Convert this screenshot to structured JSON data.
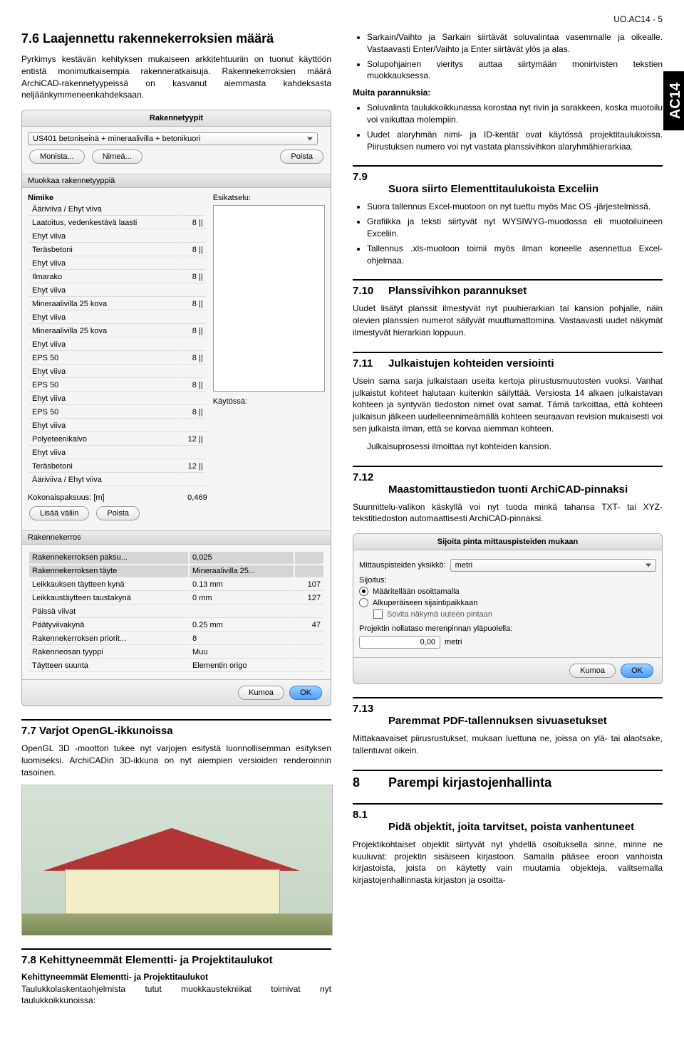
{
  "meta": {
    "top_right": "UO.AC14 - 5",
    "tab": "AC14"
  },
  "left": {
    "h76": "7.6   Laajennettu rakennekerroksien määrä",
    "p76": "Pyrkimys kestävän kehityksen mukaiseen arkkitehtuuriin on tuonut käyttöön entistä monimutkaisempia rakenneratkaisuja. Rakennekerroksien määrä ArchiCAD-rakennetyypeissä on kasvanut aiemmasta kahdeksasta neljäänkymmeneenkahdeksaan.",
    "panel1": {
      "title": "Rakennetyypit",
      "combo": "US401 betoniseinä + mineraalivilla + betonikuori",
      "btns": {
        "monista": "Monista...",
        "nimea": "Nimeä...",
        "poista": "Poista"
      },
      "sect1": "Muokkaa rakennetyyppiä",
      "col_head_l": "Nimike",
      "col_preview": "Esikatselu:",
      "rows": [
        {
          "name": "Ääriviiva / Ehyt viiva",
          "v": ""
        },
        {
          "name": "Laatoitus, vedenkestävä laasti",
          "v": "8"
        },
        {
          "name": "Ehyt viiva",
          "v": ""
        },
        {
          "name": "Teräsbetoni",
          "v": "8"
        },
        {
          "name": "Ehyt viiva",
          "v": ""
        },
        {
          "name": "Ilmarako",
          "v": "8"
        },
        {
          "name": "Ehyt viiva",
          "v": ""
        },
        {
          "name": "Mineraalivilla 25 kova",
          "v": "8"
        },
        {
          "name": "Ehyt viiva",
          "v": ""
        },
        {
          "name": "Mineraalivilla 25 kova",
          "v": "8"
        },
        {
          "name": "Ehyt viiva",
          "v": ""
        },
        {
          "name": "EPS 50",
          "v": "8"
        },
        {
          "name": "Ehyt viiva",
          "v": ""
        },
        {
          "name": "EPS 50",
          "v": "8"
        },
        {
          "name": "Ehyt viiva",
          "v": ""
        },
        {
          "name": "EPS 50",
          "v": "8"
        },
        {
          "name": "Ehyt viiva",
          "v": ""
        },
        {
          "name": "Polyeteenikalvo",
          "v": "12"
        },
        {
          "name": "Ehyt viiva",
          "v": ""
        },
        {
          "name": "Teräsbetoni",
          "v": "12"
        },
        {
          "name": "Ääriviiva / Ehyt viiva",
          "v": ""
        }
      ],
      "thickness_lbl": "Kokonaispaksuus: [m]",
      "thickness_val": "0,469",
      "kaytossa": "Käytössä:",
      "lisaa": "Lisää väliin",
      "poista2": "Poista",
      "sect2": "Rakennekerros",
      "rk_rows": [
        {
          "l": "Rakennekerroksen paksu...",
          "r": "0,025"
        },
        {
          "l": "Rakennekerroksen täyte",
          "r": "Mineraalivilla 25..."
        },
        {
          "l": "Leikkauksen täytteen kynä",
          "r": "0.13 mm",
          "r2": "107"
        },
        {
          "l": "Leikkaustäytteen taustakynä",
          "r": "0 mm",
          "r2": "127"
        },
        {
          "l": "Päissä viivat",
          "r": ""
        },
        {
          "l": "Päätyviivakynä",
          "r": "0.25 mm",
          "r2": "47"
        },
        {
          "l": "Rakennekerroksen priorit...",
          "r": "8"
        },
        {
          "l": "Rakenneosan tyyppi",
          "r": "Muu"
        },
        {
          "l": "Täytteen suunta",
          "r": "Elementin origo"
        }
      ],
      "kumoa": "Kumoa",
      "ok": "OK"
    },
    "h77": "7.7   Varjot OpenGL-ikkunoissa",
    "p77": "OpenGL 3D -moottori tukee nyt varjojen esitystä luonnollisemman esityksen luomiseksi. ArchiCADin 3D-ikkuna on nyt aiempien versioiden renderoinnin tasoinen.",
    "h78": "7.8   Kehittyneemmät Elementti- ja Projektitaulukot",
    "sub78": "Kehittyneemmät Elementti- ja Projektitaulukot",
    "p78": "Taulukkolaskentaohjelmista tutut muokkaustekniikat toimivat nyt taulukkoikkunoissa:"
  },
  "right": {
    "bul1": [
      "Sarkain/Vaihto ja Sarkain siirtävät soluvalintaa vasemmalle ja oikealle. Vastaavasti Enter/Vaihto ja Enter siirtävät ylös ja alas.",
      "Solupohjainen vieritys auttaa siirtymään monirivisten tekstien muokkauksessa."
    ],
    "muita": "Muita parannuksia:",
    "bul2": [
      "Soluvalinta taulukkoikkunassa korostaa nyt rivin ja sarakkeen, koska muotoilu voi vaikuttaa molempiin.",
      "Uudet alaryhmän nimi- ja ID-kentät ovat käytössä projektitaulukoissa. Piirustuksen numero voi nyt vastata planssivihkon alaryhmähierarkiaa."
    ],
    "h79num": "7.9",
    "h79": "Suora siirto Elementtitaulukoista Exceliin",
    "bul79": [
      "Suora tallennus Excel-muotoon on nyt tuettu myös Mac OS -järjestelmissä.",
      "Grafiikka ja teksti siirtyvät nyt WYSIWYG-muodossa eli muotoiluineen Exceliin.",
      "Tallennus .xls-muotoon toimii myös ilman koneelle asennettua Excel-ohjelmaa."
    ],
    "h710num": "7.10",
    "h710": "Planssivihkon parannukset",
    "p710": "Uudet lisätyt planssit ilmestyvät nyt puuhierarkian tai kansion pohjalle, näin olevien planssien numerot säilyvät muuttumattomina. Vastaavasti uudet näkymät ilmestyvät hierarkian loppuun.",
    "h711num": "7.11",
    "h711": "Julkaistujen kohteiden versiointi",
    "p711a": "Usein sama sarja julkaistaan useita kertoja piirustusmuutosten vuoksi. Vanhat julkaistut kohteet halutaan kuitenkin säilyttää. Versiosta 14 alkaen julkaistavan kohteen ja syntyvän tiedoston nimet ovat samat. Tämä tarkoittaa, että kohteen julkaisun jälkeen uudelleennimeämällä kohteen seuraavan revision mukaisesti voi sen julkaista ilman, että se korvaa aiemman kohteen.",
    "p711b": "Julkaisuprosessi ilmoittaa nyt kohteiden kansion.",
    "h712num": "7.12",
    "h712": "Maastomittaustiedon tuonti ArchiCAD-pinnaksi",
    "p712": "Suunnittelu-valikon käskyllä voi nyt tuoda minkä tahansa TXT- tai XYZ-tekstitiedoston automaattisesti ArchiCAD-pinnaksi.",
    "panel2": {
      "title": "Sijoita pinta mittauspisteiden mukaan",
      "unit_lbl": "Mittauspisteiden yksikkö:",
      "unit_val": "metri",
      "siirto": "Sijoitus:",
      "r1": "Määritellään osoittamalla",
      "r2": "Alkuperäiseen sijaintipaikkaan",
      "chk": "Sovita näkymä uuteen pintaan",
      "proj": "Projektin nollataso merenpinnan yläpuolella:",
      "val": "0,00",
      "m": "metri",
      "kumoa": "Kumoa",
      "ok": "OK"
    },
    "h713num": "7.13",
    "h713": "Paremmat PDF-tallennuksen sivuasetukset",
    "p713": "Mittakaavaiset piirusrustukset, mukaan luettuna ne, joissa on ylä- tai alaotsake, tallentuvat oikein.",
    "h8num": "8",
    "h8": "Parempi kirjastojenhallinta",
    "h81num": "8.1",
    "h81": "Pidä objektit, joita tarvitset, poista vanhentuneet",
    "p81": "Projektikohtaiset objektit siirtyvät nyt yhdellä osoituksella sinne, minne ne kuuluvat: projektin sisäiseen kirjastoon. Samalla pääsee eroon vanhoista kirjastoista, joista on käytetty vain muutamia objekteja, valitsemalla kirjastojenhallinnasta kirjaston ja osoitta-"
  }
}
